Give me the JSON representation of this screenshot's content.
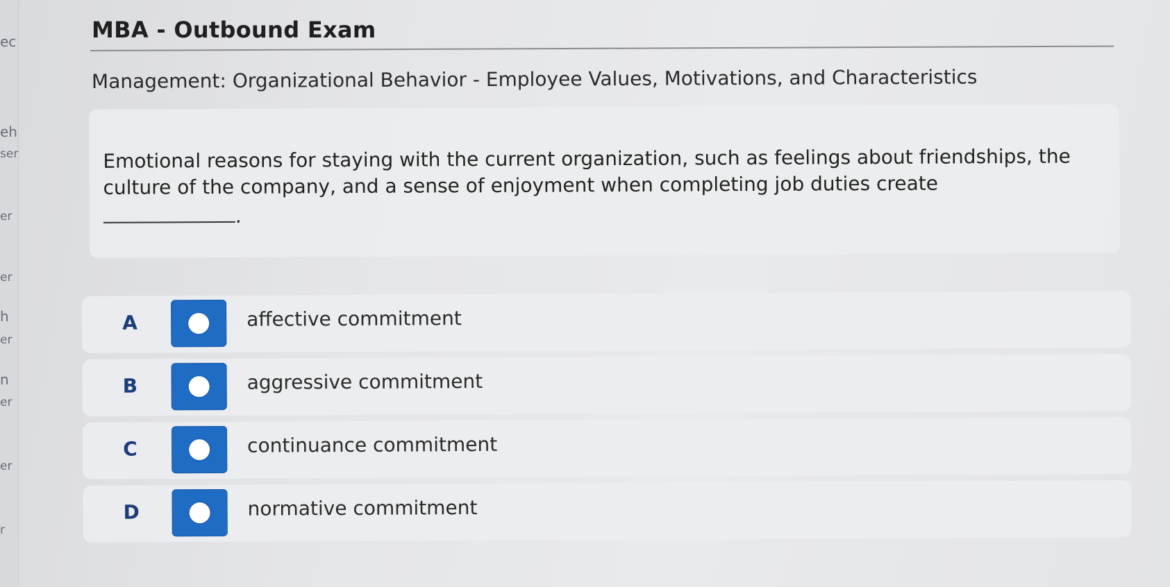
{
  "sidebar_fragments": [
    "ec",
    "eh",
    "ser",
    "er",
    "er",
    "h",
    "er",
    "n",
    "er",
    "er",
    "r"
  ],
  "exam": {
    "title": "MBA - Outbound Exam",
    "subject": "Management: Organizational Behavior - Employee Values, Motivations, and Characteristics"
  },
  "question": {
    "text": "Emotional reasons for staying with the current organization, such as feelings about friendships, the culture of the company, and a sense of enjoyment when completing job duties create",
    "blank_suffix": "."
  },
  "options": [
    {
      "letter": "A",
      "text": "affective commitment"
    },
    {
      "letter": "B",
      "text": "aggressive commitment"
    },
    {
      "letter": "C",
      "text": "continuance commitment"
    },
    {
      "letter": "D",
      "text": "normative commitment"
    }
  ],
  "colors": {
    "radio_box": "#1f6cc4",
    "option_letter": "#1d3c78"
  }
}
